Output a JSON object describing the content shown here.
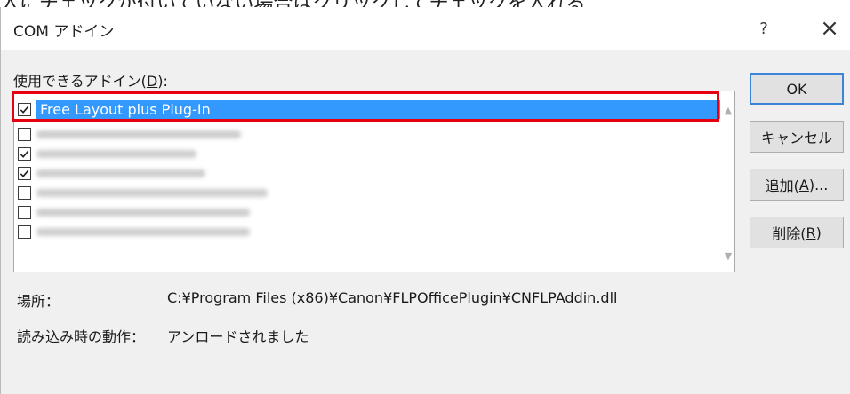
{
  "top_caption": "入にチェックが付いていない場合はクリックしてチェックを入れる",
  "dialog": {
    "title": "COM アドイン",
    "help_label": "?",
    "close_label": "×"
  },
  "list": {
    "label_prefix": "使用できるアドイン(",
    "label_key": "D",
    "label_suffix": "):",
    "items": [
      {
        "label": "Free Layout plus Plug-In",
        "checked": true,
        "selected": true
      },
      {
        "label": "",
        "checked": false,
        "selected": false
      },
      {
        "label": "",
        "checked": true,
        "selected": false
      },
      {
        "label": "",
        "checked": true,
        "selected": false
      },
      {
        "label": "",
        "checked": false,
        "selected": false
      },
      {
        "label": "",
        "checked": false,
        "selected": false
      },
      {
        "label": "",
        "checked": false,
        "selected": false
      }
    ]
  },
  "buttons": {
    "ok": "OK",
    "cancel": "キャンセル",
    "add_prefix": "追加(",
    "add_key": "A",
    "add_suffix": ")...",
    "remove_prefix": "削除(",
    "remove_key": "R",
    "remove_suffix": ")"
  },
  "info": {
    "location_label": "場所：",
    "location_value": "C:¥Program Files (x86)¥Canon¥FLPOfficePlugin¥CNFLPAddin.dll",
    "behavior_label": "読み込み時の動作：",
    "behavior_value": "アンロードされました"
  },
  "colors": {
    "selection": "#3399ff",
    "highlight_frame": "#e60012",
    "dialog_bg": "#f0f0f0"
  }
}
